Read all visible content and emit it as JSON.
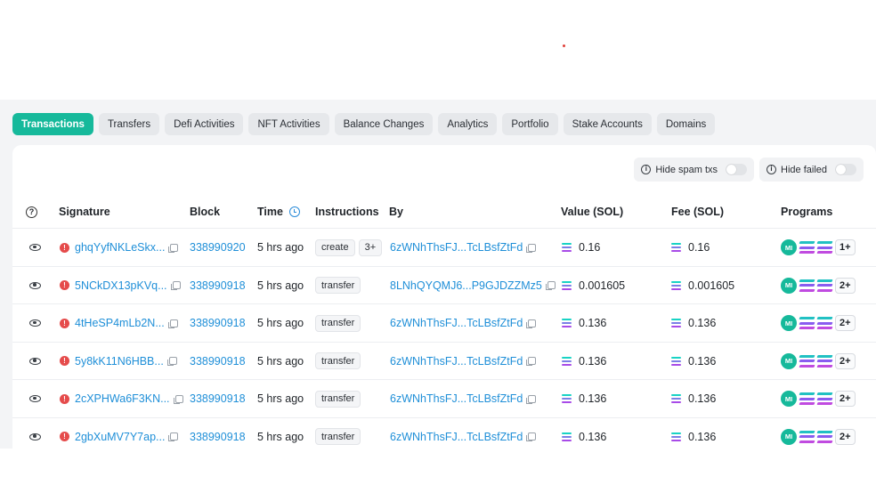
{
  "tabs": [
    {
      "label": "Transactions",
      "active": true
    },
    {
      "label": "Transfers"
    },
    {
      "label": "Defi Activities"
    },
    {
      "label": "NFT Activities"
    },
    {
      "label": "Balance Changes"
    },
    {
      "label": "Analytics"
    },
    {
      "label": "Portfolio"
    },
    {
      "label": "Stake Accounts"
    },
    {
      "label": "Domains"
    }
  ],
  "filters": {
    "hide_spam": "Hide spam txs",
    "hide_failed": "Hide failed"
  },
  "columns": {
    "help": "?",
    "signature": "Signature",
    "block": "Block",
    "time": "Time",
    "instructions": "Instructions",
    "by": "By",
    "value": "Value (SOL)",
    "fee": "Fee (SOL)",
    "programs": "Programs"
  },
  "rows": [
    {
      "signature": "ghqYyfNKLeSkx...",
      "block": "338990920",
      "time": "5 hrs ago",
      "instructions": [
        "create",
        "3+"
      ],
      "by": "6zWNhThsFJ...TcLBsfZtFd",
      "value": "0.16",
      "fee": "0.16",
      "programs_badge": "MI",
      "programs_more": "1+"
    },
    {
      "signature": "5NCkDX13pKVq...",
      "block": "338990918",
      "time": "5 hrs ago",
      "instructions": [
        "transfer"
      ],
      "by": "8LNhQYQMJ6...P9GJDZZMz5",
      "value": "0.001605",
      "fee": "0.001605",
      "programs_badge": "MI",
      "programs_more": "2+"
    },
    {
      "signature": "4tHeSP4mLb2N...",
      "block": "338990918",
      "time": "5 hrs ago",
      "instructions": [
        "transfer"
      ],
      "by": "6zWNhThsFJ...TcLBsfZtFd",
      "value": "0.136",
      "fee": "0.136",
      "programs_badge": "MI",
      "programs_more": "2+"
    },
    {
      "signature": "5y8kK11N6HBB...",
      "block": "338990918",
      "time": "5 hrs ago",
      "instructions": [
        "transfer"
      ],
      "by": "6zWNhThsFJ...TcLBsfZtFd",
      "value": "0.136",
      "fee": "0.136",
      "programs_badge": "MI",
      "programs_more": "2+"
    },
    {
      "signature": "2cXPHWa6F3KN...",
      "block": "338990918",
      "time": "5 hrs ago",
      "instructions": [
        "transfer"
      ],
      "by": "6zWNhThsFJ...TcLBsfZtFd",
      "value": "0.136",
      "fee": "0.136",
      "programs_badge": "MI",
      "programs_more": "2+"
    },
    {
      "signature": "2gbXuMV7Y7ap...",
      "block": "338990918",
      "time": "5 hrs ago",
      "instructions": [
        "transfer"
      ],
      "by": "6zWNhThsFJ...TcLBsfZtFd",
      "value": "0.136",
      "fee": "0.136",
      "programs_badge": "MI",
      "programs_more": "2+"
    }
  ],
  "colors": {
    "accent": "#16b99b",
    "link": "#1f8fd8",
    "error": "#e54b4b"
  }
}
